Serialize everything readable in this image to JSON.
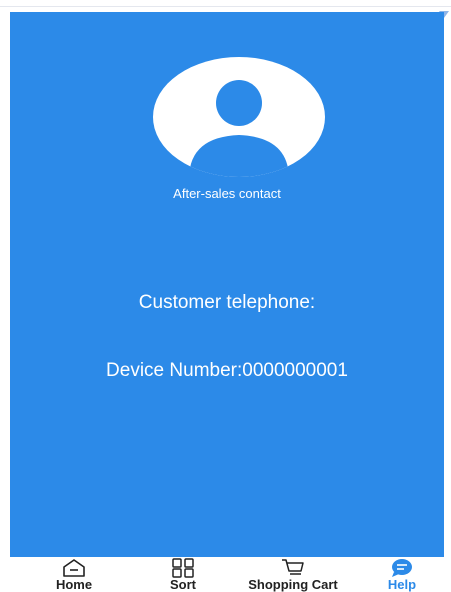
{
  "colors": {
    "primary": "#2c8ae8",
    "text_on_primary": "#ffffff",
    "tab_text": "#222222",
    "tab_active": "#2c8ae8"
  },
  "profile": {
    "avatar_icon": "person-icon",
    "caption": "After-sales contact"
  },
  "info": {
    "telephone_label": "Customer telephone:",
    "device_label": "Device Number:0000000001"
  },
  "tabbar": {
    "active": "help",
    "items": [
      {
        "id": "home",
        "label": "Home",
        "icon": "home-icon"
      },
      {
        "id": "sort",
        "label": "Sort",
        "icon": "grid-icon"
      },
      {
        "id": "cart",
        "label": "Shopping Cart",
        "icon": "cart-icon"
      },
      {
        "id": "help",
        "label": "Help",
        "icon": "chat-bubble-icon"
      }
    ]
  }
}
